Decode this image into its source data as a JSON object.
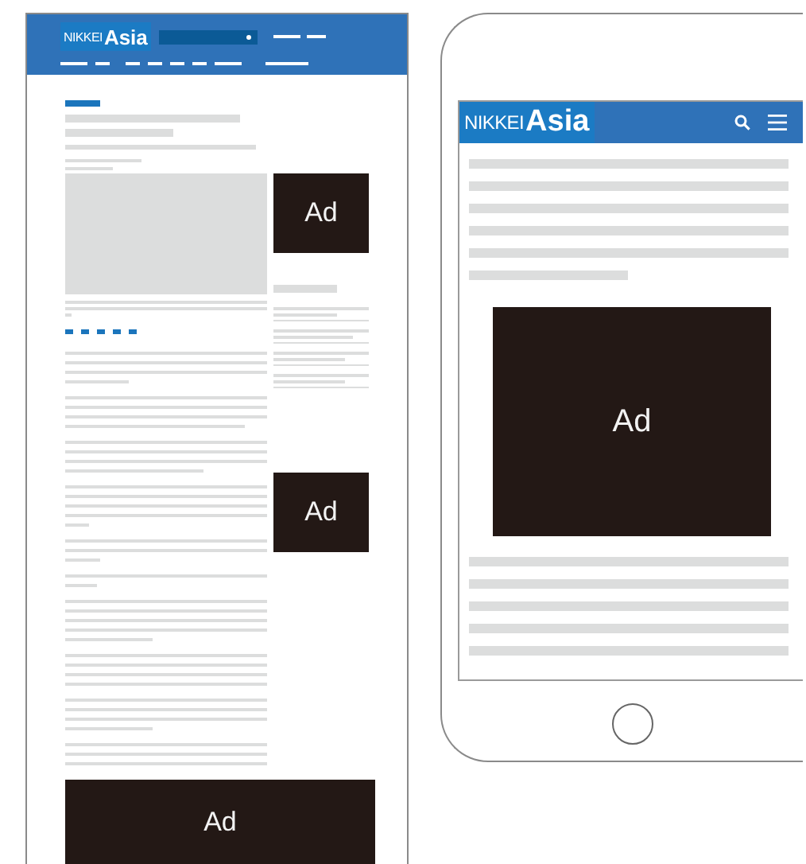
{
  "desktop": {
    "logo": {
      "brand": "NIKKEI",
      "edition": "Asia"
    },
    "ads": [
      {
        "label": "Ad",
        "kind": "side"
      },
      {
        "label": "Ad",
        "kind": "side"
      },
      {
        "label": "Ad",
        "kind": "banner"
      }
    ]
  },
  "mobile": {
    "logo": {
      "brand": "NIKKEI",
      "edition": "Asia"
    },
    "ads": [
      {
        "label": "Ad",
        "kind": "inline"
      }
    ]
  }
}
